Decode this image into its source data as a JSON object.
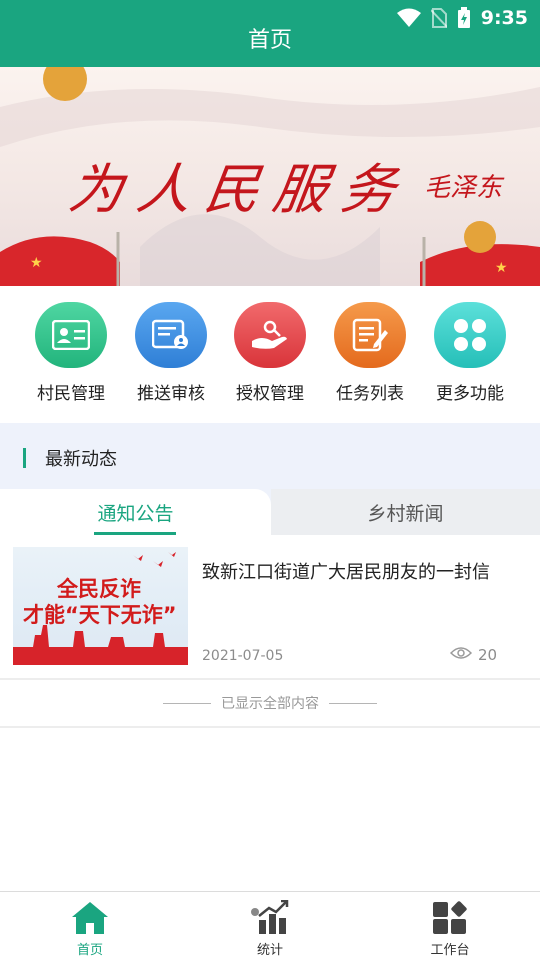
{
  "status_bar": {
    "time": "9:35",
    "icons": [
      "wifi-icon",
      "no-sim-icon",
      "battery-charging-icon"
    ]
  },
  "header": {
    "title": "首页"
  },
  "banner": {
    "calligraphy": "为人民服务",
    "signature": "毛泽东"
  },
  "functions": [
    {
      "label": "村民管理",
      "icon": "id-card-icon",
      "color": "#2fc48c"
    },
    {
      "label": "推送审核",
      "icon": "document-user-icon",
      "color": "#3f8fe0"
    },
    {
      "label": "授权管理",
      "icon": "hand-key-icon",
      "color": "#e8454a"
    },
    {
      "label": "任务列表",
      "icon": "task-list-icon",
      "color": "#ef7d2d"
    },
    {
      "label": "更多功能",
      "icon": "more-grid-icon",
      "color": "#2fcbc5"
    }
  ],
  "section": {
    "title": "最新动态"
  },
  "tabs": [
    {
      "label": "通知公告",
      "active": true
    },
    {
      "label": "乡村新闻",
      "active": false
    }
  ],
  "news": [
    {
      "thumb_line1": "全民反诈",
      "thumb_line2": "才能“天下无诈”",
      "title": "致新江口街道广大居民朋友的一封信",
      "date": "2021-07-05",
      "views": "20"
    }
  ],
  "list_end_text": "已显示全部内容",
  "bottom_nav": [
    {
      "label": "首页",
      "icon": "home-icon",
      "active": true
    },
    {
      "label": "统计",
      "icon": "stats-icon",
      "active": false
    },
    {
      "label": "工作台",
      "icon": "workbench-icon",
      "active": false
    }
  ],
  "colors": {
    "primary": "#1aa580",
    "section_bg": "#eef2fb",
    "accent_red": "#c4161c"
  }
}
